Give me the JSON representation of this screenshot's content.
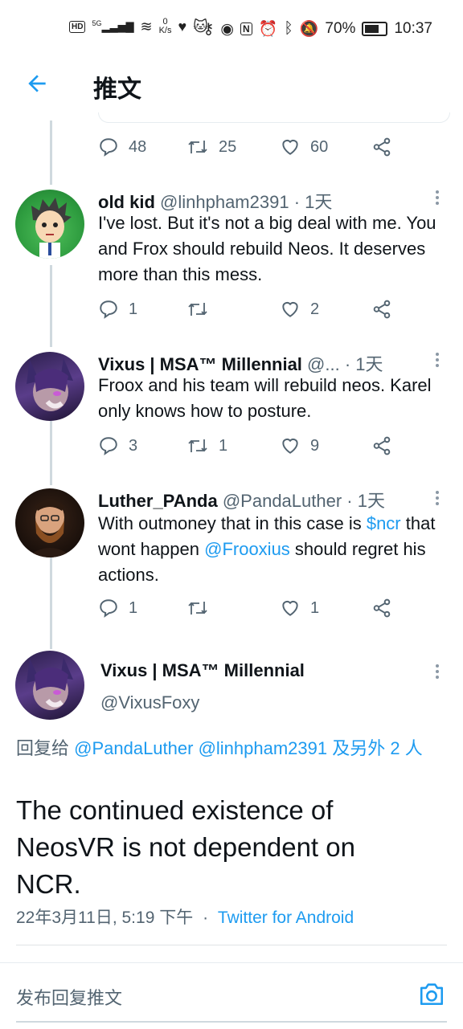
{
  "status_bar": {
    "hd": "HD",
    "network": "5G",
    "speed_value": "0",
    "speed_unit": "K/s",
    "battery": "70%",
    "time": "10:37"
  },
  "app_bar": {
    "title": "推文"
  },
  "prev_tweet_actions": {
    "replies": "48",
    "retweets": "25",
    "likes": "60"
  },
  "replies": [
    {
      "name": "old kid",
      "handle": "@linhpham2391",
      "time": "1天",
      "text": "I've lost. But it's not a big deal with me. You and Frox should rebuild Neos. It deserves more than this mess.",
      "replies": "1",
      "retweets": "",
      "likes": "2"
    },
    {
      "name": "Vixus | MSA™ Millennial",
      "handle": "@...",
      "time": "1天",
      "text": "Froox and his team will rebuild neos. Karel only knows how to posture.",
      "replies": "3",
      "retweets": "1",
      "likes": "9"
    },
    {
      "name": "Luther_PAnda",
      "handle": "@PandaLuther",
      "time": "1天",
      "text_pre": "With outmoney that in this case is ",
      "cashtag": "$ncr",
      "text_mid": " that wont happen ",
      "mention": "@Frooxius",
      "text_post": " should regret his actions.",
      "replies": "1",
      "retweets": "",
      "likes": "1"
    }
  ],
  "main_tweet": {
    "name": "Vixus | MSA™ Millennial",
    "handle": "@VixusFoxy",
    "reply_to_prefix": "回复给 ",
    "reply_to_users": "@PandaLuther @linhpham2391 及另外 2 人",
    "text": "The continued existence of NeosVR is not dependent on NCR.",
    "timestamp": "22年3月11日, 5:19 下午",
    "separator": "·",
    "source": "Twitter for Android"
  },
  "composer": {
    "placeholder": "发布回复推文"
  },
  "colors": {
    "accent": "#1d9bf0",
    "muted": "#536471",
    "text": "#0f1419"
  }
}
